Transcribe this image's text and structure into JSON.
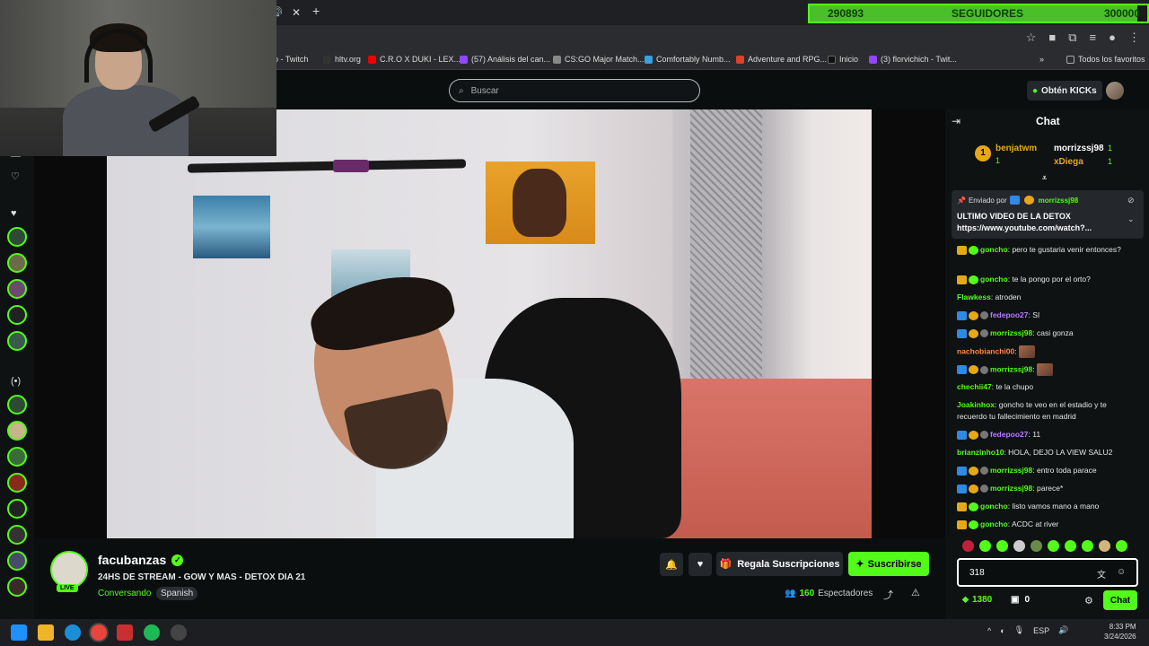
{
  "browser": {
    "bookmarks": [
      {
        "label": "do - Twitch",
        "color": "#222"
      },
      {
        "label": "hltv.org",
        "color": "#333"
      },
      {
        "label": "C.R.O X DUKI - LEX...",
        "color": "#e00"
      },
      {
        "label": "(57) Análisis del can...",
        "color": "#9146ff"
      },
      {
        "label": "CS:GO Major Match...",
        "color": "#888"
      },
      {
        "label": "Comfortably Numb...",
        "color": "#3aa0e0"
      },
      {
        "label": "Adventure and RPG...",
        "color": "#e0402a"
      },
      {
        "label": "Inicio",
        "color": "#111"
      },
      {
        "label": "(3) florvichich - Twit...",
        "color": "#9146ff"
      }
    ],
    "bookmarks_more": "»",
    "all_favorites": "Todos los favoritos"
  },
  "followers_goal": {
    "current": "290893",
    "label": "SEGUIDORES",
    "goal": "300000",
    "progress": 0.97
  },
  "topnav": {
    "search_placeholder": "Buscar",
    "obten_kicks": "Obtén KICKs"
  },
  "stream": {
    "channel": "facubanzas",
    "live": "LIVE",
    "title": "24HS DE STREAM  - GOW Y MAS - DETOX DIA 21",
    "category": "Conversando",
    "language": "Spanish",
    "gift_subs": "Regala Suscripciones",
    "subscribe": "Suscribirse",
    "viewers_count": "160",
    "viewers_label": "Espectadores"
  },
  "chat": {
    "title": "Chat",
    "leaderboard": [
      {
        "name": "benjatwm",
        "count": "1",
        "color": "#e6a817"
      },
      {
        "name": "morrizssj98",
        "count": "1",
        "color": "#ffffff"
      },
      {
        "name": "xDiega",
        "count": "1",
        "color": "#e6a817"
      }
    ],
    "pinned": {
      "by_label": "Enviado por",
      "by_user": "morrizssj98",
      "text": "ULTIMO VIDEO DE LA DETOX",
      "link": "https://www.youtube.com/watch?..."
    },
    "messages": [
      {
        "user": "goncho",
        "color": "#53fc18",
        "badges": [
          "crown",
          "ver"
        ],
        "text": "pero te gustaria venir entonces?"
      },
      {
        "user": "goncho",
        "color": "#53fc18",
        "badges": [
          "crown",
          "ver"
        ],
        "text": "te la pongo por el orto?"
      },
      {
        "user": "Flawkess",
        "color": "#53fc18",
        "badges": [],
        "text": "atroden"
      },
      {
        "user": "fedepoo27",
        "color": "#b77cff",
        "badges": [
          "arrow",
          "gold",
          "skull"
        ],
        "text": "SI"
      },
      {
        "user": "morrizssj98",
        "color": "#53fc18",
        "badges": [
          "arrow",
          "gold",
          "skull"
        ],
        "text": "casi gonza"
      },
      {
        "user": "nachobianchi00",
        "color": "#ff8a4a",
        "badges": [],
        "text": "",
        "emote": true
      },
      {
        "user": "morrizssj98",
        "color": "#53fc18",
        "badges": [
          "arrow",
          "gold",
          "skull"
        ],
        "text": "",
        "emote": true
      },
      {
        "user": "chechii47",
        "color": "#53fc18",
        "badges": [],
        "text": "te la chupo"
      },
      {
        "user": "Joakinhox",
        "color": "#53fc18",
        "badges": [],
        "text": "goncho te veo en el estadio y te recuerdo tu fallecimiento en madrid"
      },
      {
        "user": "fedepoo27",
        "color": "#b77cff",
        "badges": [
          "arrow",
          "gold",
          "skull"
        ],
        "text": "11"
      },
      {
        "user": "brianzinho10",
        "color": "#53fc18",
        "badges": [],
        "text": "HOLA, DEJO LA VIEW SALU2"
      },
      {
        "user": "morrizssj98",
        "color": "#53fc18",
        "badges": [
          "arrow",
          "gold",
          "skull"
        ],
        "text": "entro toda parace"
      },
      {
        "user": "morrizssj98",
        "color": "#53fc18",
        "badges": [
          "arrow",
          "gold",
          "skull"
        ],
        "text": "parece*"
      },
      {
        "user": "goncho",
        "color": "#53fc18",
        "badges": [
          "crown",
          "ver"
        ],
        "text": "listo vamos mano a mano"
      },
      {
        "user": "goncho",
        "color": "#53fc18",
        "badges": [
          "crown",
          "ver"
        ],
        "text": "ACDC at river"
      }
    ],
    "input_value": "318",
    "points": "1380",
    "gifts": "0",
    "send_label": "Chat"
  },
  "taskbar": {
    "lang": "ESP",
    "time": "8:33 PM",
    "date": "3/24/2026"
  }
}
